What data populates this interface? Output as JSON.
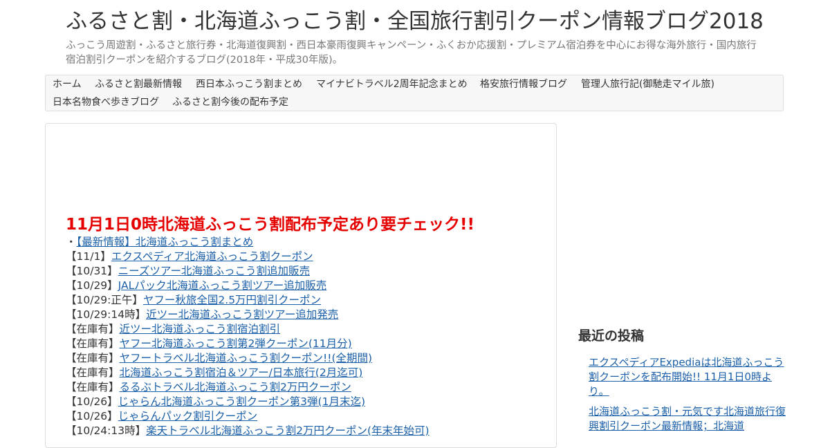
{
  "header": {
    "title": "ふるさと割・北海道ふっこう割・全国旅行割引クーポン情報ブログ2018",
    "tagline": "ふっこう周遊割・ふるさと旅行券・北海道復興割・西日本豪雨復興キャンペーン・ふくおか応援割・プレミアム宿泊券を中心にお得な海外旅行・国内旅行宿泊割引クーポンを紹介するブログ(2018年・平成30年版)。"
  },
  "nav": {
    "items": [
      {
        "label": "ホーム"
      },
      {
        "label": "ふるさと割最新情報"
      },
      {
        "label": "西日本ふっこう割まとめ"
      },
      {
        "label": "マイナビトラベル2周年記念まとめ"
      },
      {
        "label": "格安旅行情報ブログ"
      },
      {
        "label": "管理人旅行記(御馳走マイル旅)"
      },
      {
        "label": "日本名物食べ歩きブログ"
      },
      {
        "label": "ふるさと割今後の配布予定"
      }
    ]
  },
  "main": {
    "headline": "11月1日0時北海道ふっこう割配布予定あり要チェック!!",
    "links": [
      {
        "prefix": "・",
        "text": "【最新情報】北海道ふっこう割まとめ"
      },
      {
        "prefix": "【11/1】",
        "text": "エクスペディア北海道ふっこう割クーポン"
      },
      {
        "prefix": "【10/31】",
        "text": "ニーズツアー北海道ふっこう割追加販売"
      },
      {
        "prefix": "【10/29】",
        "text": "JALパック北海道ふっこう割ツアー追加販売"
      },
      {
        "prefix": "【10/29:正午】",
        "text": "ヤフー秋旅全国2.5万円割引クーポン"
      },
      {
        "prefix": "【10/29:14時】",
        "text": "近ツー北海道ふっこう割ツアー追加発売"
      },
      {
        "prefix": "【在庫有】",
        "text": "近ツー北海道ふっこう割宿泊割引"
      },
      {
        "prefix": "【在庫有】",
        "text": "ヤフー北海道ふっこう割第2弾クーポン(11月分)"
      },
      {
        "prefix": "【在庫有】",
        "text": "ヤフートラベル北海道ふっこう割クーポン!!(全期間)"
      },
      {
        "prefix": "【在庫有】",
        "text": "北海道ふっこう割宿泊＆ツアー/日本旅行(2月迄可)"
      },
      {
        "prefix": "【在庫有】",
        "text": "るるぶトラベル北海道ふっこう割2万円クーポン"
      },
      {
        "prefix": "【10/26】",
        "text": "じゃらん北海道ふっこう割クーポン第3弾(1月末迄)"
      },
      {
        "prefix": "【10/26】",
        "text": "じゃらんパック割引クーポン"
      },
      {
        "prefix": "【10/24:13時】",
        "text": "楽天トラベル北海道ふっこう割2万円クーポン(年末年始可)"
      }
    ]
  },
  "sidebar": {
    "recent_heading": "最近の投稿",
    "recent_posts": [
      {
        "text": "エクスペディアExpediaは北海道ふっこう割クーポンを配布開始!! 11月1日0時より。"
      },
      {
        "text": "北海道ふっこう割・元気です北海道旅行復興割引クーポン最新情報；北海道"
      }
    ]
  },
  "colors": {
    "headline": "#e60000",
    "link": "#1a5fa8",
    "nav_bg": "#f7f7f7"
  }
}
